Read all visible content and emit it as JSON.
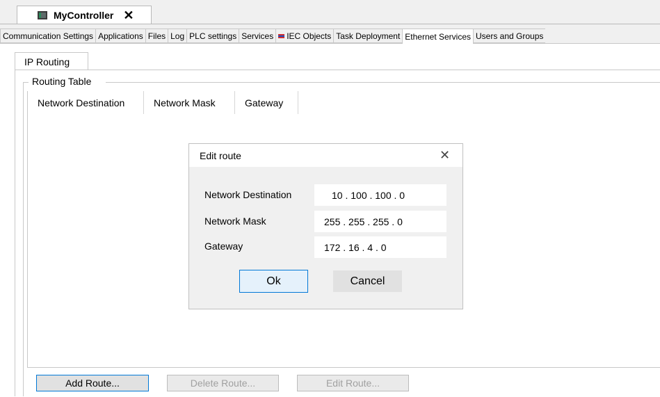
{
  "document_tab": {
    "title": "MyController",
    "close": "✕",
    "icon": "controller-icon"
  },
  "main_tabs": [
    {
      "label": "Communication Settings"
    },
    {
      "label": "Applications"
    },
    {
      "label": "Files"
    },
    {
      "label": "Log"
    },
    {
      "label": "PLC settings"
    },
    {
      "label": "Services"
    },
    {
      "label": "IEC Objects",
      "icon": "iec-objects-icon"
    },
    {
      "label": "Task Deployment"
    },
    {
      "label": "Ethernet Services",
      "active": true
    },
    {
      "label": "Users and Groups"
    }
  ],
  "sub_tab": {
    "label": "IP Routing"
  },
  "routing_table": {
    "title": "Routing Table",
    "columns": [
      "Network Destination",
      "Network Mask",
      "Gateway"
    ]
  },
  "buttons": {
    "add_route": "Add Route...",
    "delete_route": "Delete Route...",
    "edit_route": "Edit Route..."
  },
  "dialog": {
    "title": "Edit route",
    "close": "✕",
    "fields": {
      "destination_label": "Network Destination",
      "destination_value": "10 . 100 . 100 . 0",
      "mask_label": "Network Mask",
      "mask_value": "255 . 255 . 255 . 0",
      "gateway_label": "Gateway",
      "gateway_value": "172 . 16 . 4 . 0"
    },
    "ok": "Ok",
    "cancel": "Cancel"
  },
  "colors": {
    "accent": "#0078d7",
    "flag_red": "#d32f2f",
    "flag_blue": "#1f4fbf"
  }
}
